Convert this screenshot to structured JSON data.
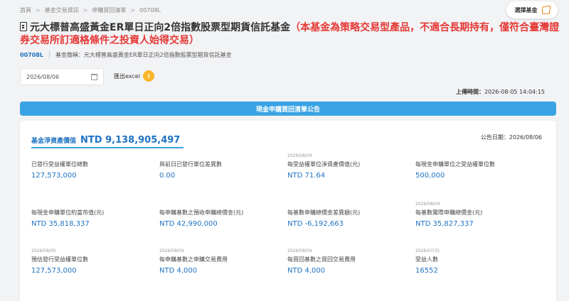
{
  "breadcrumb": [
    "首頁",
    "基金交易資訊",
    "申購買回清單",
    "00708L"
  ],
  "select_fund_label": "選擇基金",
  "title": {
    "prefix": "元大標普高盛黃金ER單日正向2倍指數股票型期貨信託基金",
    "warning": "（本基金為策略交易型產品，不適合長期持有，僅符合臺灣證券交易所訂適格條件之投資人始得交易）"
  },
  "fund": {
    "code": "00708L",
    "name_label": "基金簡稱：元大標普高盛黃金ER單日正向2倍指數股票型期貨信託基金"
  },
  "date_input": {
    "value": "2026/08/06"
  },
  "export_label": "匯出excel",
  "updated": {
    "label": "上傳時間：",
    "value": "2026-08-05 14:04:15"
  },
  "banner_title": "現金申購買回清單公告",
  "nav": {
    "label": "基金淨資產價值",
    "value": "NTD 9,138,905,497"
  },
  "announce_date": "公告日期：2026/08/06",
  "grid": [
    {
      "date": "",
      "label": "已發行受益權單位總數",
      "value": "127,573,000"
    },
    {
      "date": "",
      "label": "與前日已發行單位差異數",
      "value": "0.00"
    },
    {
      "date": "2026/08/04",
      "label": "每受益權單位淨資產價值(元)",
      "value": "NTD 71.64"
    },
    {
      "date": "",
      "label": "每現金申購單位之受益權單位數",
      "value": "500,000"
    },
    {
      "date": "",
      "label": "每現金申購單位約當市值(元)",
      "value": "NTD 35,818,337"
    },
    {
      "date": "",
      "label": "每申購基數之預收申購總價金(元)",
      "value": "NTD 42,990,000"
    },
    {
      "date": "",
      "label": "每基數申購總價金差異額(元)",
      "value": "NTD -6,192,663"
    },
    {
      "date": "2026/08/04",
      "label": "每基數實際申購總價金(元)",
      "value": "NTD 35,827,337"
    },
    {
      "date": "2026/08/05",
      "label": "預估發行受益權單位數",
      "value": "127,573,000"
    },
    {
      "date": "2026/08/04",
      "label": "每申購基數之申購交易費用",
      "value": "NTD 4,000"
    },
    {
      "date": "2026/08/04",
      "label": "每買回基數之買回交易費用",
      "value": "NTD 4,000"
    },
    {
      "date": "2026/07/31",
      "label": "受益人數",
      "value": "16552"
    }
  ]
}
